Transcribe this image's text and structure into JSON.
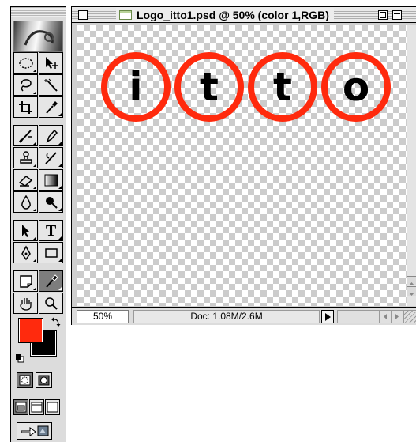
{
  "document": {
    "title": "Logo_itto1.psd @ 50% (color 1,RGB)",
    "zoom": "50%",
    "doc_size": "Doc: 1.08M/2.6M"
  },
  "artwork": {
    "ring_color": "#ff2a0d",
    "letter_color": "#000000",
    "letters": [
      "i",
      "t",
      "t",
      "o"
    ]
  },
  "toolbox": {
    "foreground_color": "#ff2a0d",
    "background_color": "#000000",
    "tools": [
      {
        "name": "marquee-tool-icon"
      },
      {
        "name": "move-tool-icon"
      },
      {
        "name": "lasso-tool-icon"
      },
      {
        "name": "magic-wand-tool-icon"
      },
      {
        "name": "crop-tool-icon"
      },
      {
        "name": "eyedropper-tool-icon"
      },
      {
        "name": "airbrush-tool-icon"
      },
      {
        "name": "pencil-tool-icon"
      },
      {
        "name": "rubber-stamp-tool-icon"
      },
      {
        "name": "history-brush-tool-icon"
      },
      {
        "name": "eraser-tool-icon"
      },
      {
        "name": "gradient-tool-icon"
      },
      {
        "name": "blur-tool-icon"
      },
      {
        "name": "burn-tool-icon"
      },
      {
        "name": "path-selection-tool-icon"
      },
      {
        "name": "type-tool-icon"
      },
      {
        "name": "pen-tool-icon"
      },
      {
        "name": "rectangle-tool-icon"
      },
      {
        "name": "notes-tool-icon"
      },
      {
        "name": "eyedropper-selected-tool-icon"
      },
      {
        "name": "hand-tool-icon"
      },
      {
        "name": "zoom-tool-icon"
      }
    ],
    "type_tool_label": "T"
  }
}
